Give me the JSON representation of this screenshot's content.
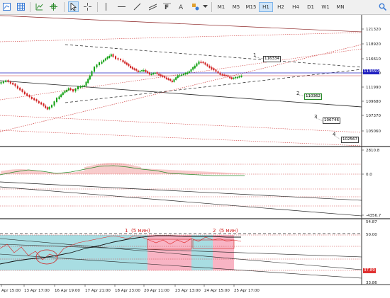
{
  "toolbar": {
    "timeframes": [
      "M1",
      "M5",
      "M15",
      "H1",
      "H2",
      "H4",
      "D1",
      "W1",
      "MN"
    ],
    "active_timeframe": "H1",
    "icons": [
      "chart-properties-icon",
      "grid-icon",
      "line-chart-icon",
      "crosshair-add-icon",
      "cursor-icon",
      "crosshair-icon",
      "vertical-line-icon",
      "horizontal-line-icon",
      "trend-line-icon",
      "channel-icon",
      "fibonacci-icon",
      "text-icon",
      "shapes-icon",
      "search-icon"
    ]
  },
  "price_axis": {
    "labels": [
      "121320",
      "118920",
      "116610",
      "114300",
      "111990",
      "109680",
      "107370",
      "105060"
    ],
    "current_price": "113650",
    "current_price_color": "#2020c0"
  },
  "main_chart": {
    "annotations": [
      {
        "number": "1",
        "price": "116334"
      },
      {
        "number": "2",
        "price": "110362"
      },
      {
        "number": "3",
        "price": "106746"
      },
      {
        "number": "4",
        "price": "102567"
      }
    ]
  },
  "macd_panel": {
    "labels": [
      "2810.8",
      "0.0",
      "-4356.7"
    ]
  },
  "rsi_panel": {
    "labels": [
      "54.87",
      "50.00",
      "37.89",
      "33.86"
    ],
    "current_value": "37.89",
    "current_value_color": "#e03030",
    "zone_label_1": "1",
    "zone_text_1": "(5 мин)",
    "zone_label_2": "2",
    "zone_text_2": "(5 мин)",
    "zone_colors": {
      "blue": "#a8dde2",
      "pink": "#f8b4c4"
    }
  },
  "time_axis": {
    "labels": [
      "Apr 15:00",
      "13 Apr 17:00",
      "16 Apr 19:00",
      "17 Apr 21:00",
      "18 Apr 23:00",
      "20 Apr 11:00",
      "23 Apr 13:00",
      "24 Apr 15:00",
      "25 Apr 17:00"
    ]
  },
  "colors": {
    "bull_candle": "#10a010",
    "bear_candle": "#d02020",
    "trend_red": "#c03030",
    "trend_dark": "#404040"
  }
}
